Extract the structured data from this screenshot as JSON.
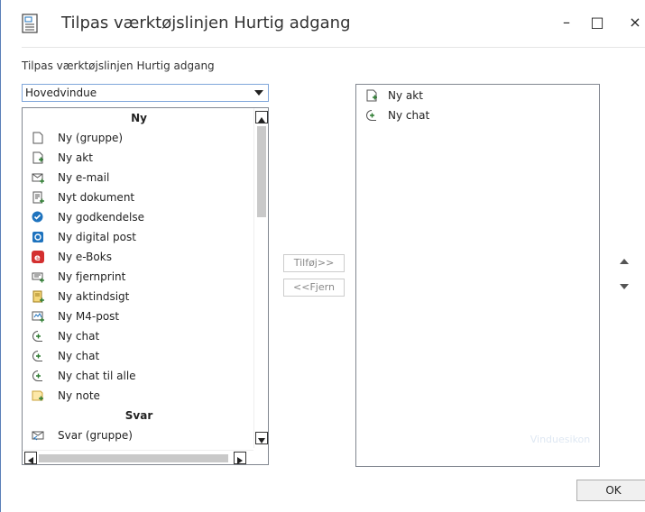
{
  "window": {
    "title": "Tilpas værktøjslinjen Hurtig adgang",
    "minimize": "–",
    "maximize": "□",
    "close": "×"
  },
  "subtitle": "Tilpas værktøjslinjen Hurtig adgang",
  "dropdown": {
    "selected": "Hovedvindue"
  },
  "left_list": {
    "groups": [
      {
        "header": "Ny"
      },
      {
        "header": "Svar"
      }
    ],
    "items": [
      {
        "label": "Ny (gruppe)",
        "icon": "blank-document-icon"
      },
      {
        "label": "Ny akt",
        "icon": "new-document-plus-icon"
      },
      {
        "label": "Ny e-mail",
        "icon": "new-email-icon"
      },
      {
        "label": "Nyt dokument",
        "icon": "new-text-document-icon"
      },
      {
        "label": "Ny godkendelse",
        "icon": "approval-check-icon"
      },
      {
        "label": "Ny digital post",
        "icon": "digital-post-icon"
      },
      {
        "label": "Ny e-Boks",
        "icon": "eboks-icon"
      },
      {
        "label": "Ny fjernprint",
        "icon": "remote-print-icon"
      },
      {
        "label": "Ny aktindsigt",
        "icon": "access-request-icon"
      },
      {
        "label": "Ny M4-post",
        "icon": "m4-post-icon"
      },
      {
        "label": "Ny chat",
        "icon": "chat-plus-icon"
      },
      {
        "label": "Ny chat",
        "icon": "chat-plus-icon"
      },
      {
        "label": "Ny chat til alle",
        "icon": "chat-plus-icon"
      },
      {
        "label": "Ny note",
        "icon": "note-plus-icon"
      },
      {
        "label": "Svar (gruppe)",
        "icon": "reply-email-icon"
      }
    ]
  },
  "buttons": {
    "add": "Tilføj>>",
    "remove": "<<Fjern",
    "ok": "OK"
  },
  "right_list": {
    "items": [
      {
        "label": "Ny akt",
        "icon": "new-document-plus-icon"
      },
      {
        "label": "Ny chat",
        "icon": "chat-plus-icon"
      }
    ]
  },
  "faded_label": "Vinduesikon",
  "colors": {
    "accent": "#2e7d32",
    "border_focus": "#7fa6da",
    "eboks_red": "#d32f2f",
    "approval_blue": "#1e73be"
  }
}
